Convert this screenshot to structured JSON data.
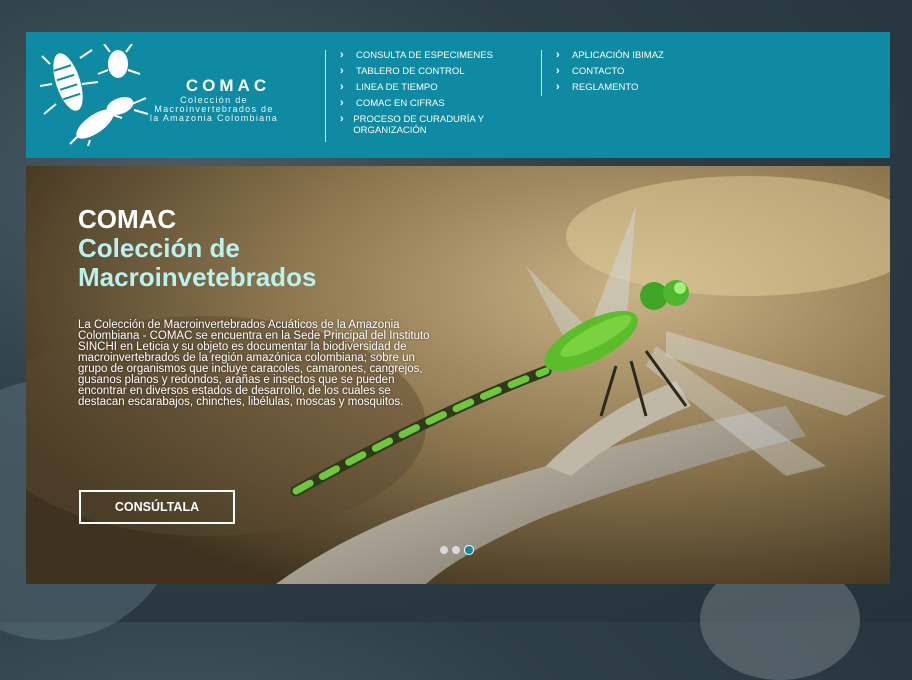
{
  "brand": {
    "title": "COMAC",
    "subtitle_lines": [
      "Colección de",
      "Macroinvertebrados de",
      "la Amazonia Colombiana"
    ]
  },
  "nav": {
    "column1": [
      "CONSULTA DE ESPECIMENES",
      "TABLERO DE CONTROL",
      "LINEA DE TIEMPO",
      "COMAC EN CIFRAS",
      "PROCESO DE CURADURÍA Y ORGANIZACIÓN"
    ],
    "column2": [
      "APLICACIÓN IBIMAZ",
      "CONTACTO",
      "REGLAMENTO"
    ]
  },
  "hero": {
    "title_line1": "COMAC",
    "title_line2": "Colección de Macroinvetebrados",
    "description": "La Colección de Macroinvertebrados Acuáticos de la Amazonia Colombiana - COMAC se encuentra en la Sede Principal del Instituto SINCHI en Leticia y su objeto es documentar la biodiversidad de macroinvertebrados de la región amazónica colombiana; sobre un grupo de organismos que incluye caracoles, camarones, cangrejos, gusanos planos y redondos, arañas e insectos que se pueden encontrar en diversos estados de desarrollo, de los cuales se destacan escarabajos, chinches, libélulas, moscas y mosquitos.",
    "cta_label": "CONSÚLTALA",
    "active_slide": 3,
    "slide_count": 3
  },
  "colors": {
    "header_bg": "#0f8aa3",
    "accent_text": "#b7f2ef"
  }
}
